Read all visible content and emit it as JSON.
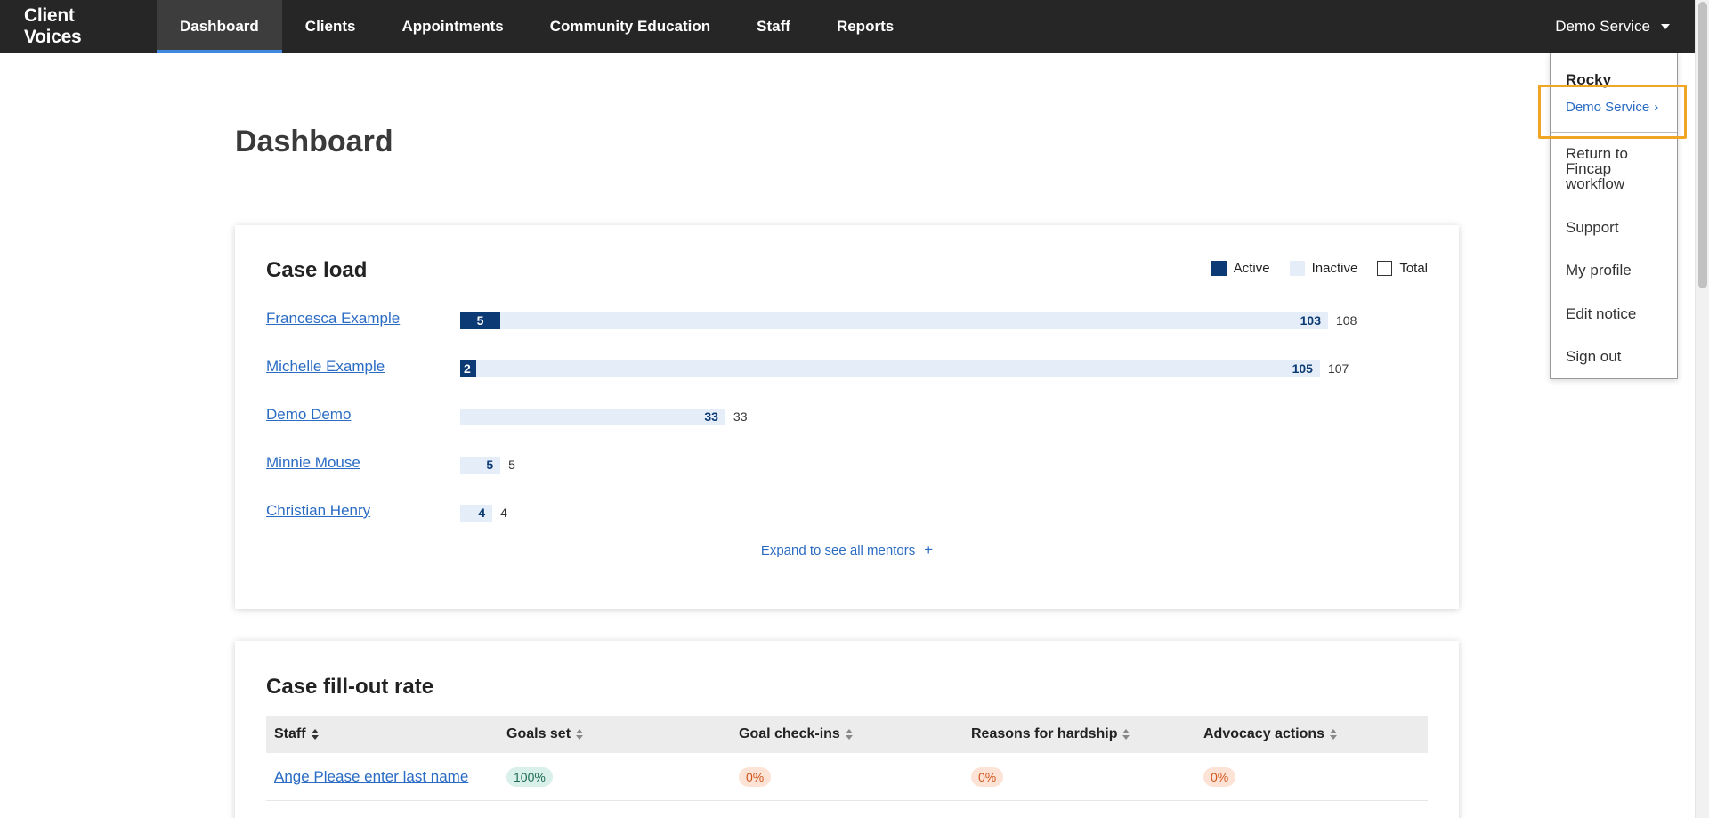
{
  "nav": {
    "brand": "Client Voices",
    "items": [
      {
        "label": "Dashboard",
        "active": true
      },
      {
        "label": "Clients"
      },
      {
        "label": "Appointments"
      },
      {
        "label": "Community Education"
      },
      {
        "label": "Staff"
      },
      {
        "label": "Reports"
      }
    ],
    "service_menu": "Demo Service"
  },
  "page_title": "Dashboard",
  "caseload": {
    "title": "Case load",
    "legend": {
      "active": "Active",
      "inactive": "Inactive",
      "total": "Total"
    },
    "rows": [
      {
        "name": "Francesca Example",
        "active": 5,
        "inactive": 103,
        "total": 108,
        "active_label": "5",
        "inactive_label": "103",
        "total_label": "108"
      },
      {
        "name": "Michelle Example",
        "active": 2,
        "inactive": 105,
        "total": 107,
        "active_label": "2",
        "inactive_label": "105",
        "total_label": "107"
      },
      {
        "name": "Demo Demo",
        "active": 0,
        "inactive": 33,
        "total": 33,
        "active_label": "",
        "inactive_label": "33",
        "total_label": "33"
      },
      {
        "name": "Minnie Mouse",
        "active": 0,
        "inactive": 5,
        "total": 5,
        "active_label": "",
        "inactive_label": "5",
        "total_label": "5"
      },
      {
        "name": "Christian Henry",
        "active": 0,
        "inactive": 4,
        "total": 4,
        "active_label": "",
        "inactive_label": "4",
        "total_label": "4"
      }
    ],
    "expand_label": "Expand to see all mentors",
    "max_total": 108
  },
  "fillout": {
    "title": "Case fill-out rate",
    "columns": [
      "Staff",
      "Goals set",
      "Goal check-ins",
      "Reasons for hardship",
      "Advocacy actions"
    ],
    "rows": [
      {
        "staff": "Ange Please enter last name",
        "goals_set": "100%",
        "check_ins": "0%",
        "hardship": "0%",
        "advocacy": "0%"
      }
    ]
  },
  "dropdown": {
    "user": "Rocky",
    "service": "Demo Service",
    "items": [
      "Return to Fincap workflow",
      "Support",
      "My profile",
      "Edit notice",
      "Sign out"
    ]
  },
  "colors": {
    "active": "#0b3a75",
    "inactive": "#e5eef8",
    "link": "#2a6bc3",
    "highlight": "#f0a624"
  }
}
